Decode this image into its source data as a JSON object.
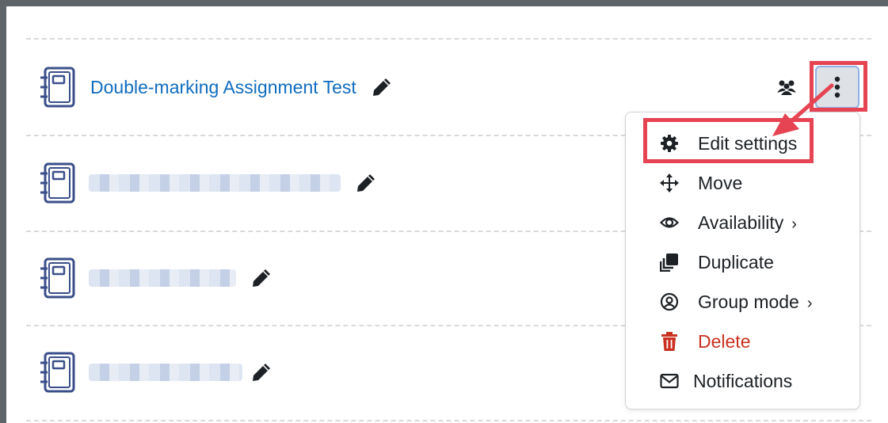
{
  "activities": [
    {
      "title": "Double-marking Assignment Test",
      "blurred": false
    },
    {
      "title": "",
      "blurred": true
    },
    {
      "title": "",
      "blurred": true
    },
    {
      "title": "",
      "blurred": true
    }
  ],
  "icons": {
    "activity": "assignment-notebook-icon",
    "edit_title": "pencil-icon",
    "group_mode": "group-icon",
    "actions_menu": "kebab-vertical-icon"
  },
  "menu": {
    "items": [
      {
        "label": "Edit settings",
        "icon": "gear-icon",
        "submenu": false
      },
      {
        "label": "Move",
        "icon": "move-arrows-icon",
        "submenu": false
      },
      {
        "label": "Availability",
        "icon": "eye-icon",
        "submenu": true
      },
      {
        "label": "Duplicate",
        "icon": "duplicate-icon",
        "submenu": false
      },
      {
        "label": "Group mode",
        "icon": "user-circle-icon",
        "submenu": true
      },
      {
        "label": "Delete",
        "icon": "trash-icon",
        "submenu": false
      },
      {
        "label": "Notifications",
        "icon": "envelope-icon",
        "submenu": false
      }
    ]
  },
  "annotation": {
    "color": "#e64452"
  },
  "colors": {
    "link": "#0f6cbf",
    "delete": "#ca3120",
    "icon_navy": "#3a4f8a"
  }
}
